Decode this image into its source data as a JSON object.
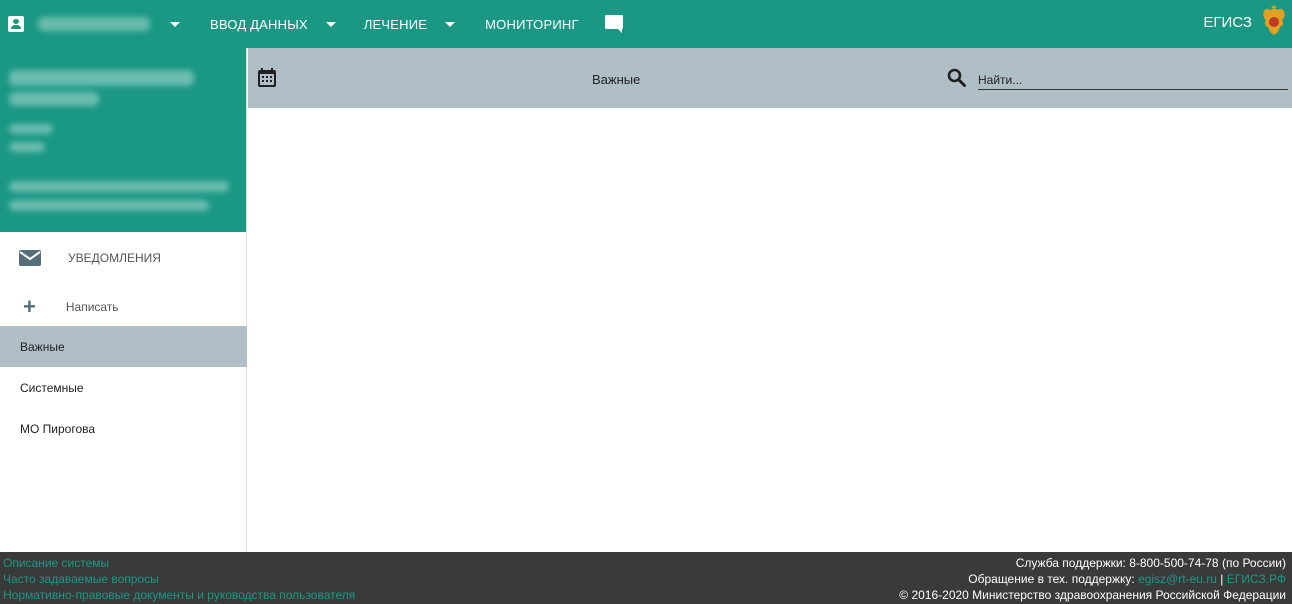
{
  "topbar": {
    "menu_data_entry": "ВВОД ДАННЫХ",
    "menu_treatment": "ЛЕЧЕНИЕ",
    "menu_monitoring": "МОНИТОРИНГ",
    "brand": "ЕГИСЗ",
    "accent": "#1a9884"
  },
  "sidebar": {
    "notifications_label": "УВЕДОМЛЕНИЯ",
    "compose_label": "Написать",
    "folders": [
      {
        "label": "Важные",
        "active": true
      },
      {
        "label": "Системные",
        "active": false
      },
      {
        "label": "МО Пирогова",
        "active": false
      }
    ]
  },
  "subheader": {
    "title": "Важные",
    "search_placeholder": "Найти..."
  },
  "footer": {
    "links": [
      "Описание системы",
      "Часто задаваемые вопросы",
      "Нормативно-правовые документы и руководства пользователя"
    ],
    "support_line": "Служба поддержки: 8-800-500-74-78 (по России)",
    "tech_prefix": "Обращение в тех. поддержку:",
    "tech_email": "egisz@rt-eu.ru",
    "tech_sep": "|",
    "tech_site": "ЕГИСЗ.РФ",
    "copyright": "© 2016-2020 Министерство здравоохранения Российской Федерации"
  }
}
